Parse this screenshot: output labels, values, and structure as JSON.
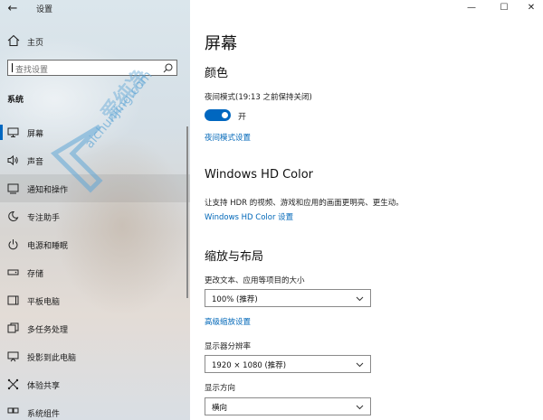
{
  "window": {
    "title": "设置",
    "controls": {
      "minimize": "—",
      "maximize": "☐",
      "close": "✕"
    }
  },
  "sidebar": {
    "home_label": "主页",
    "search_placeholder": "查找设置",
    "section_label": "系统",
    "items": [
      {
        "label": "屏幕",
        "icon": "display-icon",
        "selected": true
      },
      {
        "label": "声音",
        "icon": "speaker-icon"
      },
      {
        "label": "通知和操作",
        "icon": "notification-icon",
        "hovered": true
      },
      {
        "label": "专注助手",
        "icon": "moon-icon"
      },
      {
        "label": "电源和睡眠",
        "icon": "power-icon"
      },
      {
        "label": "存储",
        "icon": "storage-icon"
      },
      {
        "label": "平板电脑",
        "icon": "tablet-icon"
      },
      {
        "label": "多任务处理",
        "icon": "multitask-icon"
      },
      {
        "label": "投影到此电脑",
        "icon": "project-icon"
      },
      {
        "label": "体验共享",
        "icon": "share-icon"
      },
      {
        "label": "系统组件",
        "icon": "components-icon"
      }
    ]
  },
  "watermark": {
    "text": "爱纯净",
    "url": "aichunjing.com"
  },
  "main": {
    "page_title": "屏幕",
    "color": {
      "heading": "颜色",
      "night_mode_label": "夜间模式(19:13 之前保持关闭)",
      "toggle_state": "开",
      "toggle_on": true,
      "night_mode_link": "夜间模式设置"
    },
    "hd_color": {
      "heading": "Windows HD Color",
      "description": "让支持 HDR 的视频、游戏和应用的画面更明亮、更生动。",
      "link": "Windows HD Color 设置"
    },
    "scale_layout": {
      "heading": "缩放与布局",
      "scale_label": "更改文本、应用等项目的大小",
      "scale_value": "100% (推荐)",
      "advanced_link": "高级缩放设置",
      "resolution_label": "显示器分辨率",
      "resolution_value": "1920 × 1080 (推荐)",
      "orientation_label": "显示方向",
      "orientation_value": "横向"
    }
  },
  "colors": {
    "accent": "#0067c0",
    "link": "#0067b8"
  }
}
